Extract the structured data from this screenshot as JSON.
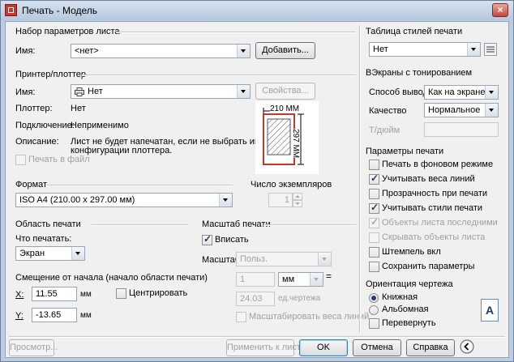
{
  "window": {
    "title": "Печать - Модель",
    "close": "×"
  },
  "page_setup": {
    "group": "Набор параметров листа",
    "name_label": "Имя:",
    "name_value": "<нет>",
    "add_button": "Добавить..."
  },
  "printer": {
    "group": "Принтер/плоттер",
    "name_label": "Имя:",
    "name_value": "Нет",
    "properties_button": "Свойства...",
    "plotter_label": "Плоттер:",
    "plotter_value": "Нет",
    "connection_label": "Подключение:",
    "connection_value": "Неприменимо",
    "description_label": "Описание:",
    "description_value_1": "Лист не будет напечатан, если не выбрать имя",
    "description_value_2": "конфигурации плоттера.",
    "print_to_file": "Печать в файл",
    "preview_width": "210 MM",
    "preview_height": "297 MM"
  },
  "format": {
    "group": "Формат",
    "value": "ISO A4 (210.00 x 297.00 мм)"
  },
  "copies": {
    "group": "Число экземпляров",
    "value": "1"
  },
  "plot_area": {
    "group": "Область печати",
    "what_label": "Что печатать:",
    "what_value": "Экран"
  },
  "offset": {
    "group": "Смещение от начала (начало области печати)",
    "x_label": "X:",
    "x_value": "11.55",
    "x_unit": "мм",
    "y_label": "Y:",
    "y_value": "-13.65",
    "y_unit": "мм",
    "center": "Центрировать"
  },
  "scale": {
    "group": "Масштаб печати",
    "fit": "Вписать",
    "scale_label": "Масштаб:",
    "scale_value": "Польз.",
    "num_value": "1",
    "unit_value": "мм",
    "den_value": "24.03",
    "den_unit": "ед.чертежа",
    "lineweights": "Масштабировать веса линий"
  },
  "style_table": {
    "group": "Таблица стилей печати",
    "value": "Нет"
  },
  "shaded": {
    "group": "ВЭкраны с тонированием",
    "output_label": "Способ вывода",
    "output_value": "Как на экране",
    "quality_label": "Качество",
    "quality_value": "Нормальное",
    "dpi_label": "Т/дюйм"
  },
  "options": {
    "group": "Параметры печати",
    "items": [
      "Печать в фоновом режиме",
      "Учитывать веса линий",
      "Прозрачность при печати",
      "Учитывать стили печати",
      "Объекты листа последними",
      "Скрывать объекты листа",
      "Штемпель вкл",
      "Сохранить параметры"
    ]
  },
  "orientation": {
    "group": "Ориентация чертежа",
    "portrait": "Книжная",
    "landscape": "Альбомная",
    "upside_down": "Перевернуть",
    "icon_letter": "A"
  },
  "footer": {
    "preview": "Просмотр...",
    "apply": "Применить к листу",
    "ok": "OK",
    "cancel": "Отмена",
    "help": "Справка"
  }
}
